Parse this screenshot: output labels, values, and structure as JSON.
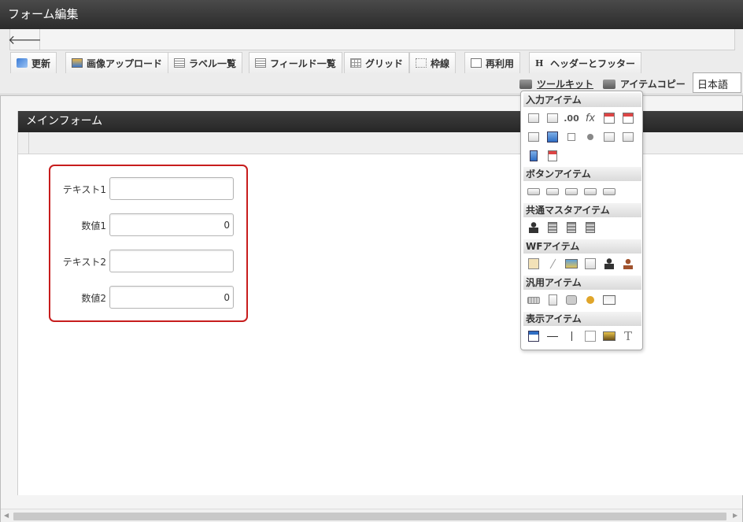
{
  "window": {
    "title": "フォーム編集"
  },
  "nav": {
    "back_icon": "arrow-left-icon",
    "back_glyph": "🡐"
  },
  "tabs": [
    {
      "label": "更新",
      "icon": "refresh-icon"
    },
    {
      "label": "画像アップロード",
      "icon": "image-upload-icon"
    },
    {
      "label": "ラベル一覧",
      "icon": "list-icon"
    },
    {
      "label": "フィールド一覧",
      "icon": "list-icon"
    },
    {
      "label": "グリッド",
      "icon": "grid-icon"
    },
    {
      "label": "枠線",
      "icon": "frame-icon"
    },
    {
      "label": "再利用",
      "icon": "document-icon"
    },
    {
      "label": "ヘッダーとフッター",
      "icon": "header-icon"
    }
  ],
  "header_icon_letter": "H",
  "toolbar2": {
    "toolkit_label": "ツールキット",
    "item_copy_label": "アイテムコピー",
    "language_value": "日本語"
  },
  "form": {
    "title": "メインフォーム",
    "fields": [
      {
        "label": "テキスト1",
        "value": ""
      },
      {
        "label": "数値1",
        "value": "0"
      },
      {
        "label": "テキスト2",
        "value": ""
      },
      {
        "label": "数値2",
        "value": "0"
      }
    ]
  },
  "toolkit": {
    "sections": [
      {
        "title": "入力アイテム",
        "tools": [
          "textbox-icon",
          "textarea-icon",
          "number-icon",
          "fx-icon",
          "date-icon",
          "datetime-icon",
          "listbox-icon",
          "table-input-icon",
          "checkbox-icon",
          "radio-icon",
          "pulldown-icon",
          "list-icon",
          "file-upload-icon",
          "font-icon"
        ],
        "fx_label": "fx",
        "number_label": ".00"
      },
      {
        "title": "ボタンアイテム",
        "tools": [
          "submit-button-icon",
          "next-button-icon",
          "prev-button-icon",
          "back-button-icon",
          "forward-button-icon"
        ]
      },
      {
        "title": "共通マスタアイテム",
        "tools": [
          "user-icon",
          "organization-icon",
          "public-group-icon",
          "private-group-icon"
        ]
      },
      {
        "title": "WFアイテム",
        "tools": [
          "clipboard-icon",
          "attachment-icon",
          "image-icon",
          "history-icon",
          "user-search-icon",
          "stamp-icon"
        ]
      },
      {
        "title": "汎用アイテム",
        "tools": [
          "barcode-icon",
          "document-icon",
          "camera-icon",
          "key-icon",
          "browser-icon"
        ]
      },
      {
        "title": "表示アイテム",
        "tools": [
          "label-icon",
          "horizontal-line-icon",
          "vertical-line-icon",
          "frame-icon",
          "image-icon",
          "text-icon"
        ],
        "text_label": "T"
      }
    ]
  },
  "colors": {
    "titlebar": "#2b2b2b",
    "group_border": "#c71d1d"
  }
}
